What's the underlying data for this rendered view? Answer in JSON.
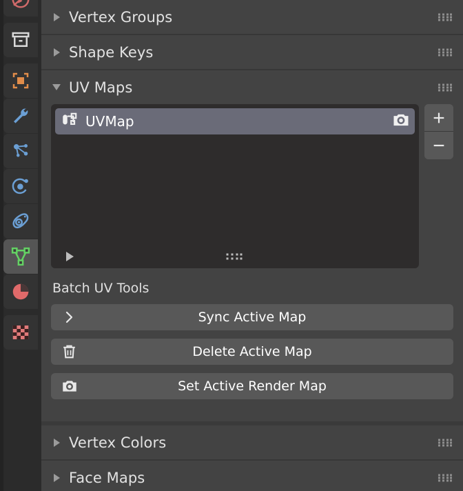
{
  "tabs": [
    {
      "name": "world-properties",
      "icon": "globe-icon",
      "color": "#d06a6a",
      "active": false
    },
    {
      "name": "object-properties-box",
      "icon": "archive-box-icon",
      "color": "#d9d9d9",
      "active": false
    },
    {
      "name": "object-properties",
      "icon": "object-square-icon",
      "color": "#e08c4a",
      "active": false
    },
    {
      "name": "modifier-properties",
      "icon": "wrench-icon",
      "color": "#6b9fd4",
      "active": false
    },
    {
      "name": "particle-properties",
      "icon": "particles-icon",
      "color": "#6b9fd4",
      "active": false
    },
    {
      "name": "physics-properties",
      "icon": "physics-orbit-icon",
      "color": "#6b9fd4",
      "active": false
    },
    {
      "name": "object-constraint-properties",
      "icon": "constraint-icon",
      "color": "#6b9fd4",
      "active": false
    },
    {
      "name": "object-data-properties",
      "icon": "mesh-data-triangle-icon",
      "color": "#64d164",
      "active": true
    },
    {
      "name": "material-properties",
      "icon": "material-sphere-icon",
      "color": "#d85f5f",
      "active": false
    },
    {
      "name": "texture-properties",
      "icon": "texture-checker-icon",
      "color": "#d85f5f",
      "active": false
    }
  ],
  "panels": {
    "vertex_groups": {
      "label": "Vertex Groups",
      "expanded": false
    },
    "shape_keys": {
      "label": "Shape Keys",
      "expanded": false
    },
    "uv_maps": {
      "label": "UV Maps",
      "expanded": true
    },
    "vertex_colors": {
      "label": "Vertex Colors",
      "expanded": false
    },
    "face_maps": {
      "label": "Face Maps",
      "expanded": false
    }
  },
  "uv_maps": {
    "items": [
      {
        "name": "UVMap",
        "active": true,
        "render_active": true
      }
    ],
    "add_button_label": "+",
    "remove_button_label": "−",
    "filter_toggle": "expand-filter-arrow",
    "resize_grip": "list-resize-grip"
  },
  "batch_uv_tools": {
    "label": "Batch UV Tools",
    "buttons": [
      {
        "label": "Sync Active Map",
        "icon": "chevron-right-icon"
      },
      {
        "label": "Delete Active Map",
        "icon": "trash-icon"
      },
      {
        "label": "Set Active Render Map",
        "icon": "camera-icon"
      }
    ]
  },
  "colors": {
    "panel_bg": "#434343",
    "list_bg": "#2e2c2c",
    "selected_row": "#6a6b78",
    "button_bg": "#585858",
    "tab_column_bg": "#2b2b2b",
    "text": "#e2e2e2",
    "active_tab_bg": "#555555"
  }
}
